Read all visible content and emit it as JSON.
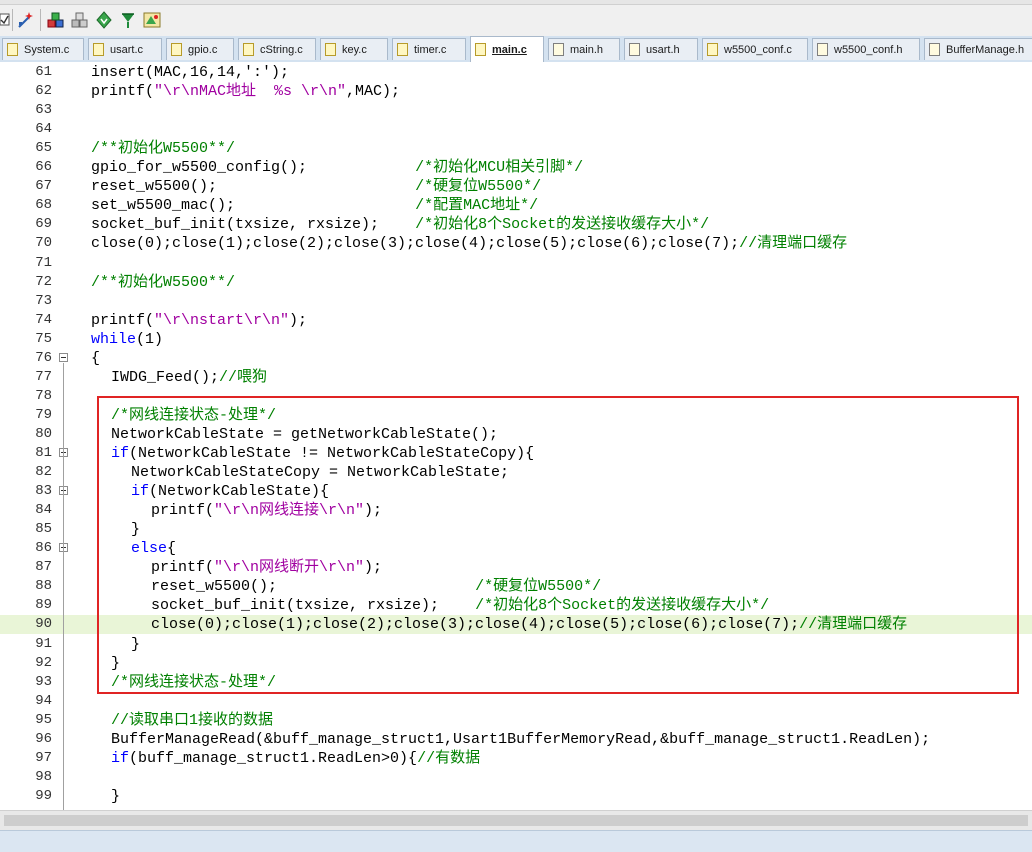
{
  "toolbar": {
    "icons": [
      "checkbox-icon",
      "wizard-icon",
      "build-icon",
      "rebuild-icon",
      "download-icon",
      "debug-icon",
      "options-icon"
    ]
  },
  "tabs": [
    {
      "label": "System.c",
      "active": false
    },
    {
      "label": "usart.c",
      "active": false
    },
    {
      "label": "gpio.c",
      "active": false
    },
    {
      "label": "cString.c",
      "active": false
    },
    {
      "label": "key.c",
      "active": false
    },
    {
      "label": "timer.c",
      "active": false
    },
    {
      "label": "main.c",
      "active": true
    },
    {
      "label": "main.h",
      "active": false
    },
    {
      "label": "usart.h",
      "active": false
    },
    {
      "label": "w5500_conf.c",
      "active": false
    },
    {
      "label": "w5500_conf.h",
      "active": false
    },
    {
      "label": "BufferManage.h",
      "active": false
    }
  ],
  "colors": {
    "keyword": "#0000ff",
    "string": "#a000a0",
    "comment": "#008000",
    "highlight_box": "#e02424",
    "current_line": "#e9f5d7"
  },
  "lines": [
    {
      "n": "61",
      "indent": 0,
      "tokens": [
        [
          "t",
          "insert(MAC,16,14,':');"
        ]
      ]
    },
    {
      "n": "62",
      "indent": 0,
      "tokens": [
        [
          "t",
          "printf("
        ],
        [
          "s",
          "\"\\r\\nMAC地址  %s \\r\\n\""
        ],
        [
          "t",
          ",MAC);"
        ]
      ]
    },
    {
      "n": "63",
      "indent": 0,
      "tokens": []
    },
    {
      "n": "64",
      "indent": 0,
      "tokens": []
    },
    {
      "n": "65",
      "indent": 0,
      "tokens": [
        [
          "c",
          "/**初始化W5500**/"
        ]
      ]
    },
    {
      "n": "66",
      "indent": 0,
      "tokens": [
        [
          "t",
          "gpio_for_w5500_config();            "
        ],
        [
          "c",
          "/*初始化MCU相关引脚*/"
        ]
      ]
    },
    {
      "n": "67",
      "indent": 0,
      "tokens": [
        [
          "t",
          "reset_w5500();                      "
        ],
        [
          "c",
          "/*硬复位W5500*/"
        ]
      ]
    },
    {
      "n": "68",
      "indent": 0,
      "tokens": [
        [
          "t",
          "set_w5500_mac();                    "
        ],
        [
          "c",
          "/*配置MAC地址*/"
        ]
      ]
    },
    {
      "n": "69",
      "indent": 0,
      "tokens": [
        [
          "t",
          "socket_buf_init(txsize, rxsize);    "
        ],
        [
          "c",
          "/*初始化8个Socket的发送接收缓存大小*/"
        ]
      ]
    },
    {
      "n": "70",
      "indent": 0,
      "tokens": [
        [
          "t",
          "close(0);close(1);close(2);close(3);close(4);close(5);close(6);close(7);"
        ],
        [
          "c",
          "//清理端口缓存"
        ]
      ]
    },
    {
      "n": "71",
      "indent": 0,
      "tokens": []
    },
    {
      "n": "72",
      "indent": 0,
      "tokens": [
        [
          "c",
          "/**初始化W5500**/"
        ]
      ]
    },
    {
      "n": "73",
      "indent": 0,
      "tokens": []
    },
    {
      "n": "74",
      "indent": 0,
      "tokens": [
        [
          "t",
          "printf("
        ],
        [
          "s",
          "\"\\r\\nstart\\r\\n\""
        ],
        [
          "t",
          ");"
        ]
      ]
    },
    {
      "n": "75",
      "indent": 0,
      "tokens": [
        [
          "k",
          "while"
        ],
        [
          "t",
          "(1)"
        ]
      ]
    },
    {
      "n": "76",
      "indent": 0,
      "tokens": [
        [
          "t",
          "{"
        ]
      ],
      "fold": true
    },
    {
      "n": "77",
      "indent": 1,
      "tokens": [
        [
          "t",
          "IWDG_Feed();"
        ],
        [
          "c",
          "//喂狗"
        ]
      ]
    },
    {
      "n": "78",
      "indent": 0,
      "tokens": []
    },
    {
      "n": "79",
      "indent": 1,
      "tokens": [
        [
          "c",
          "/*网线连接状态-处理*/"
        ]
      ]
    },
    {
      "n": "80",
      "indent": 1,
      "tokens": [
        [
          "t",
          "NetworkCableState = getNetworkCableState();"
        ]
      ]
    },
    {
      "n": "81",
      "indent": 1,
      "tokens": [
        [
          "k",
          "if"
        ],
        [
          "t",
          "(NetworkCableState != NetworkCableStateCopy){"
        ]
      ],
      "fold": true
    },
    {
      "n": "82",
      "indent": 2,
      "tokens": [
        [
          "t",
          "NetworkCableStateCopy = NetworkCableState;"
        ]
      ]
    },
    {
      "n": "83",
      "indent": 2,
      "tokens": [
        [
          "k",
          "if"
        ],
        [
          "t",
          "(NetworkCableState){"
        ]
      ],
      "fold": true
    },
    {
      "n": "84",
      "indent": 3,
      "tokens": [
        [
          "t",
          "printf("
        ],
        [
          "s",
          "\"\\r\\n网线连接\\r\\n\""
        ],
        [
          "t",
          ");"
        ]
      ]
    },
    {
      "n": "85",
      "indent": 2,
      "tokens": [
        [
          "t",
          "}"
        ]
      ]
    },
    {
      "n": "86",
      "indent": 2,
      "tokens": [
        [
          "k",
          "else"
        ],
        [
          "t",
          "{"
        ]
      ],
      "fold": true
    },
    {
      "n": "87",
      "indent": 3,
      "tokens": [
        [
          "t",
          "printf("
        ],
        [
          "s",
          "\"\\r\\n网线断开\\r\\n\""
        ],
        [
          "t",
          ");"
        ]
      ]
    },
    {
      "n": "88",
      "indent": 3,
      "tokens": [
        [
          "t",
          "reset_w5500();                      "
        ],
        [
          "c",
          "/*硬复位W5500*/"
        ]
      ]
    },
    {
      "n": "89",
      "indent": 3,
      "tokens": [
        [
          "t",
          "socket_buf_init(txsize, rxsize);    "
        ],
        [
          "c",
          "/*初始化8个Socket的发送接收缓存大小*/"
        ]
      ]
    },
    {
      "n": "90",
      "indent": 3,
      "tokens": [
        [
          "t",
          "close(0);close(1);close(2);close(3);close(4);close(5);close(6);close(7);"
        ],
        [
          "c",
          "//清理端口缓存"
        ]
      ],
      "current": true
    },
    {
      "n": "91",
      "indent": 2,
      "tokens": [
        [
          "t",
          "}"
        ]
      ]
    },
    {
      "n": "92",
      "indent": 1,
      "tokens": [
        [
          "t",
          "}"
        ]
      ]
    },
    {
      "n": "93",
      "indent": 1,
      "tokens": [
        [
          "c",
          "/*网线连接状态-处理*/"
        ]
      ]
    },
    {
      "n": "94",
      "indent": 0,
      "tokens": []
    },
    {
      "n": "95",
      "indent": 1,
      "tokens": [
        [
          "c",
          "//读取串口1接收的数据"
        ]
      ]
    },
    {
      "n": "96",
      "indent": 1,
      "tokens": [
        [
          "t",
          "BufferManageRead(&buff_manage_struct1,Usart1BufferMemoryRead,&buff_manage_struct1.ReadLen);"
        ]
      ]
    },
    {
      "n": "97",
      "indent": 1,
      "tokens": [
        [
          "k",
          "if"
        ],
        [
          "t",
          "(buff_manage_struct1.ReadLen>0){"
        ],
        [
          "c",
          "//有数据"
        ]
      ]
    },
    {
      "n": "98",
      "indent": 0,
      "tokens": []
    },
    {
      "n": "99",
      "indent": 1,
      "tokens": [
        [
          "t",
          "}"
        ]
      ]
    }
  ]
}
